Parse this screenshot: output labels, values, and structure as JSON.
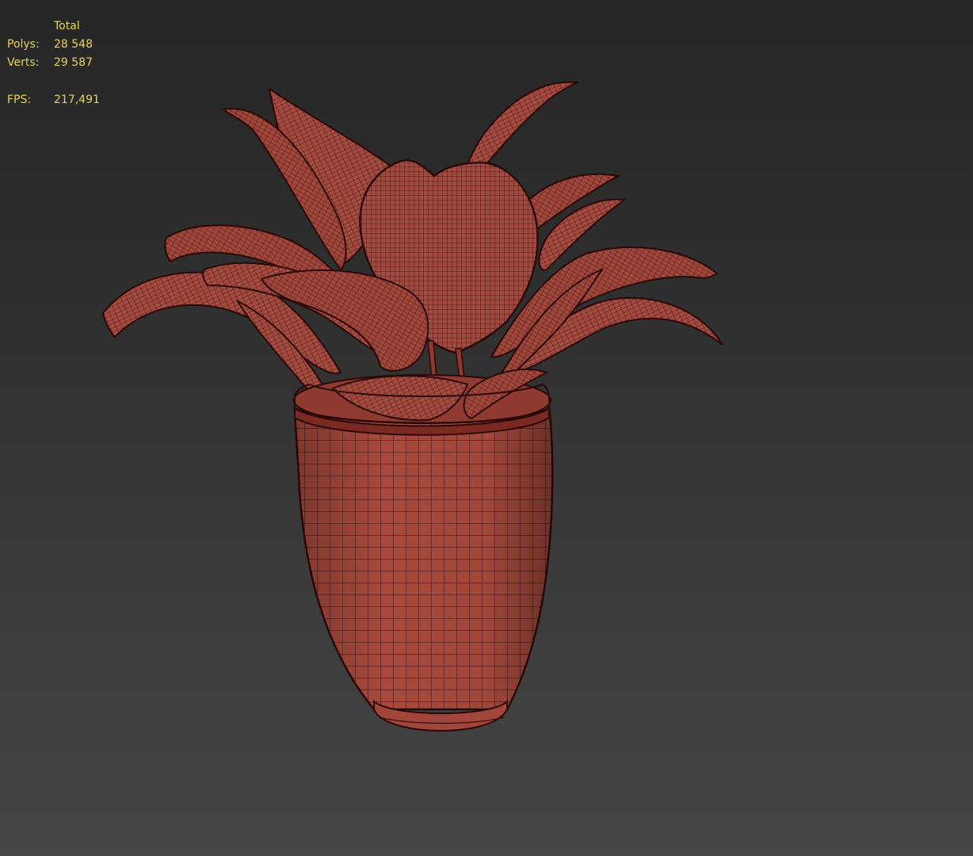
{
  "viewport": {
    "stats": {
      "header": "Total",
      "polys_label": "Polys:",
      "polys_value": "28 548",
      "verts_label": "Verts:",
      "verts_value": "29 587",
      "fps_label": "FPS:",
      "fps_value": "217,491"
    },
    "model": {
      "description_icon": "potted-plant-wireframe",
      "mesh_color": "#a64a3e",
      "wire_color": "#3a0c0a"
    }
  }
}
